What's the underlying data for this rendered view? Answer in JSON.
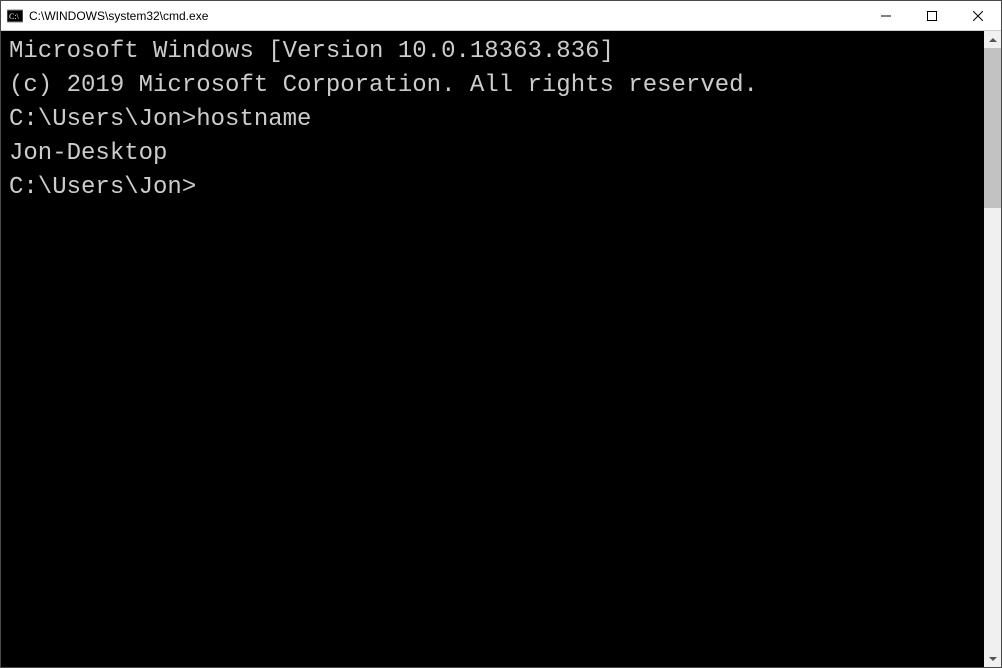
{
  "window": {
    "title": "C:\\WINDOWS\\system32\\cmd.exe"
  },
  "terminal": {
    "line1": "Microsoft Windows [Version 10.0.18363.836]",
    "line2": "(c) 2019 Microsoft Corporation. All rights reserved.",
    "blank1": "",
    "prompt1_path": "C:\\Users\\Jon>",
    "prompt1_cmd": "hostname",
    "output1": "Jon-Desktop",
    "blank2": "",
    "prompt2_path": "C:\\Users\\Jon>"
  }
}
